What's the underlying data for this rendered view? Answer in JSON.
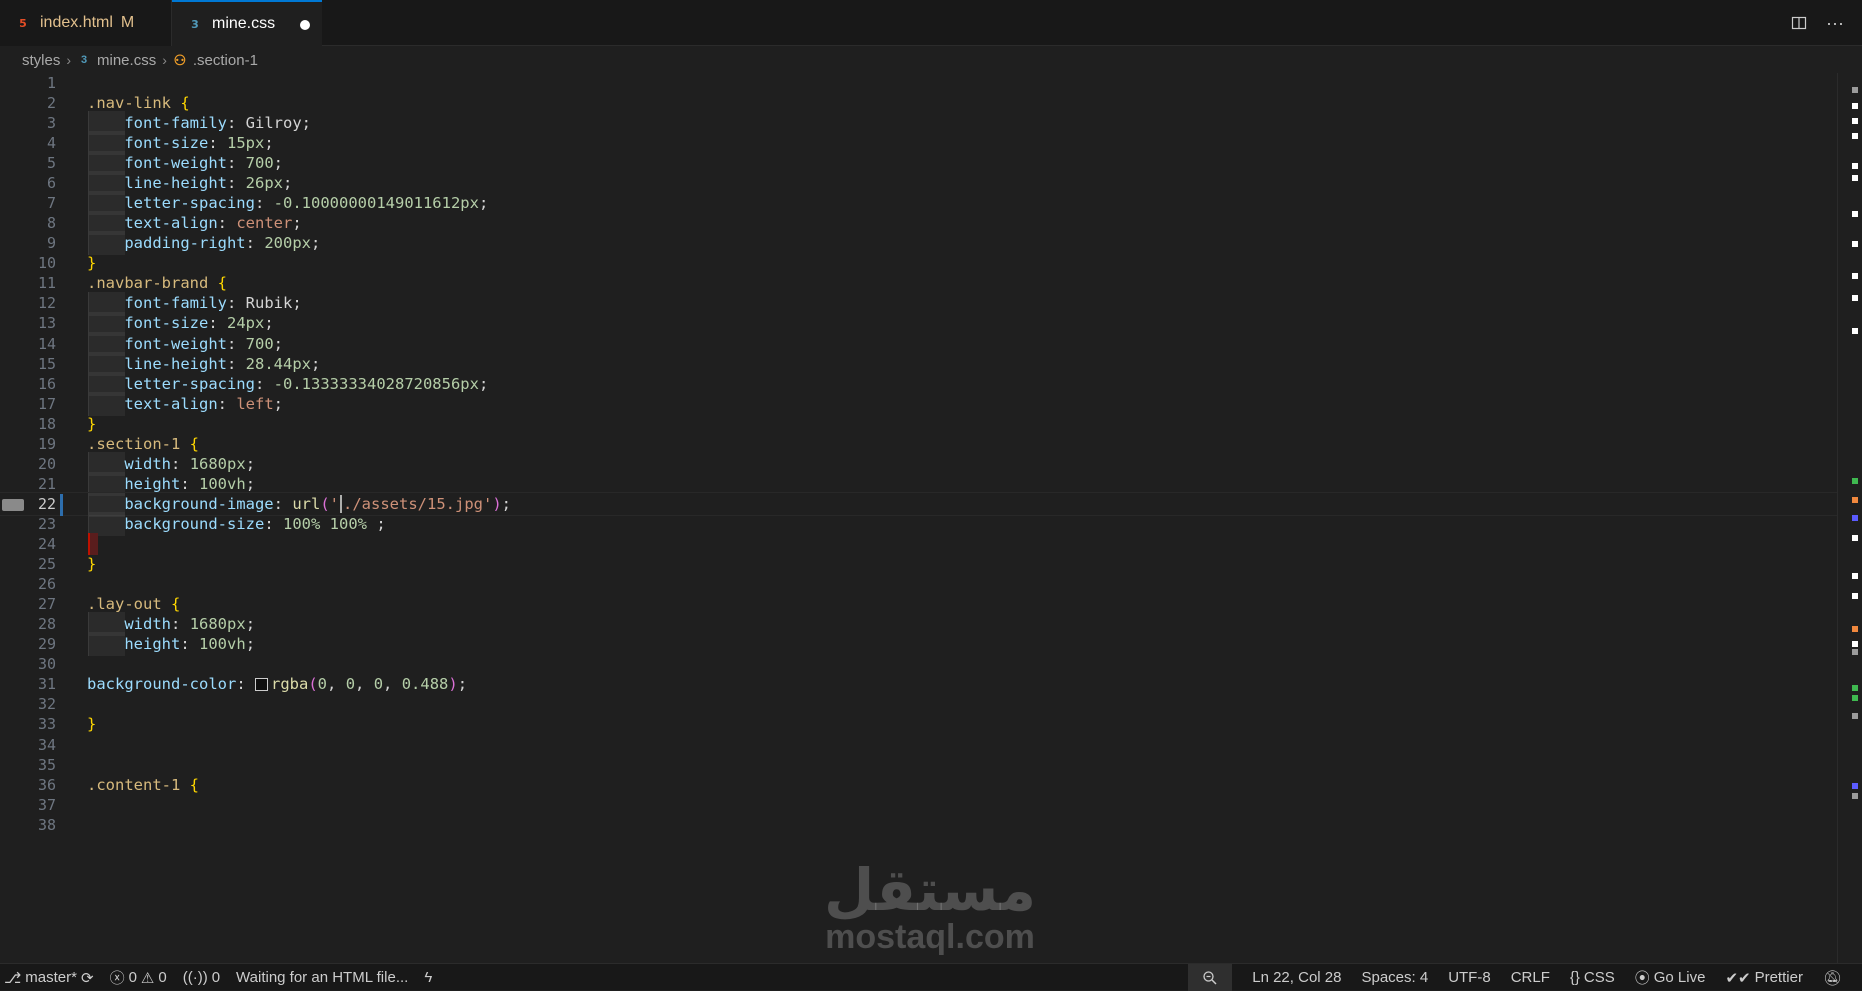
{
  "tabs": [
    {
      "label": "index.html",
      "modified": "M",
      "icon": "html5-icon"
    },
    {
      "label": "mine.css",
      "icon": "css3-icon"
    }
  ],
  "breadcrumb": {
    "folder": "styles",
    "file": "mine.css",
    "symbol": ".section-1"
  },
  "editor": {
    "active_line": 22,
    "lines": [
      {
        "n": "1",
        "t": ""
      },
      {
        "n": "2",
        "t": ".nav-link {"
      },
      {
        "n": "3",
        "t": "    font-family: Gilroy;"
      },
      {
        "n": "4",
        "t": "    font-size: 15px;"
      },
      {
        "n": "5",
        "t": "    font-weight: 700;"
      },
      {
        "n": "6",
        "t": "    line-height: 26px;"
      },
      {
        "n": "7",
        "t": "    letter-spacing: -0.10000000149011612px;"
      },
      {
        "n": "8",
        "t": "    text-align: center;"
      },
      {
        "n": "9",
        "t": "    padding-right: 200px;"
      },
      {
        "n": "10",
        "t": "}"
      },
      {
        "n": "11",
        "t": ".navbar-brand {"
      },
      {
        "n": "12",
        "t": "    font-family: Rubik;"
      },
      {
        "n": "13",
        "t": "    font-size: 24px;"
      },
      {
        "n": "14",
        "t": "    font-weight: 700;"
      },
      {
        "n": "15",
        "t": "    line-height: 28.44px;"
      },
      {
        "n": "16",
        "t": "    letter-spacing: -0.13333334028720856px;"
      },
      {
        "n": "17",
        "t": "    text-align: left;"
      },
      {
        "n": "18",
        "t": "}"
      },
      {
        "n": "19",
        "t": ".section-1 {"
      },
      {
        "n": "20",
        "t": "    width: 1680px;"
      },
      {
        "n": "21",
        "t": "    height: 100vh;"
      },
      {
        "n": "22",
        "t": "    background-image: url('./assets/15.jpg');"
      },
      {
        "n": "23",
        "t": "    background-size: 100% 100% ;"
      },
      {
        "n": "24",
        "t": ""
      },
      {
        "n": "25",
        "t": "}"
      },
      {
        "n": "26",
        "t": ""
      },
      {
        "n": "27",
        "t": ".lay-out {"
      },
      {
        "n": "28",
        "t": "    width: 1680px;"
      },
      {
        "n": "29",
        "t": "    height: 100vh;"
      },
      {
        "n": "30",
        "t": ""
      },
      {
        "n": "31",
        "t": "background-color: rgba(0, 0, 0, 0.488);"
      },
      {
        "n": "32",
        "t": ""
      },
      {
        "n": "33",
        "t": "}"
      },
      {
        "n": "34",
        "t": ""
      },
      {
        "n": "35",
        "t": ""
      },
      {
        "n": "36",
        "t": ".content-1 {"
      },
      {
        "n": "37",
        "t": ""
      },
      {
        "n": "38",
        "t": ""
      }
    ]
  },
  "watermark": {
    "arabic": "مستقل",
    "latin": "mostaql.com"
  },
  "status": {
    "branch": "master*",
    "errors": "0",
    "warnings": "0",
    "ports": "0",
    "message": "Waiting for an HTML file...",
    "cursor": "Ln 22, Col 28",
    "spaces": "Spaces: 4",
    "encoding": "UTF-8",
    "eol": "CRLF",
    "language": "CSS",
    "golive": "Go Live",
    "prettier": "Prettier"
  }
}
